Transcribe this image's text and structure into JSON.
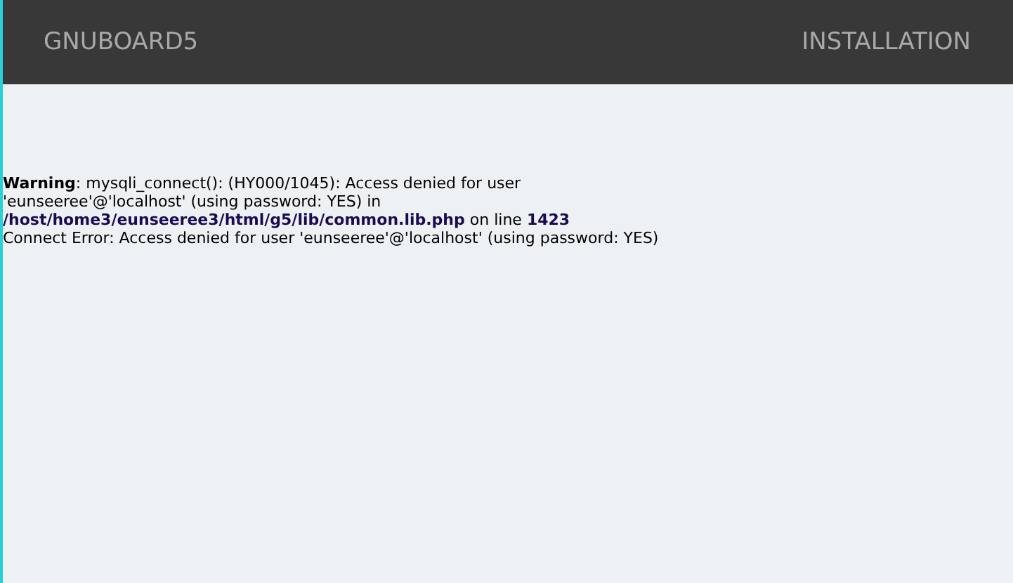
{
  "header": {
    "title": "GNUBOARD5",
    "subtitle": "INSTALLATION"
  },
  "messages": [
    {
      "kind": "warning",
      "text": "**Warning**: mysqli_connect(): (HY000/1045): Access denied for user 'eunseeree'@'localhost' (using password: YES) in **/host/home3/eunseeree3/html/g5/lib/common.lib.php** on line **1423**"
    },
    {
      "kind": "plain",
      "text": "Connect Error: Access denied for user 'eunseeree'@'localhost' (using password: YES)"
    }
  ]
}
